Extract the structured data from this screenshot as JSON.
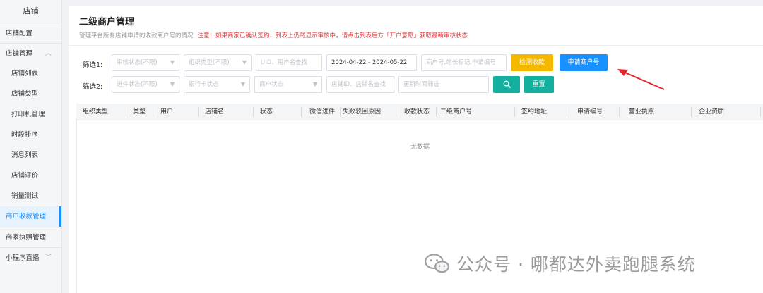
{
  "sidebar": {
    "title": "店铺",
    "items": [
      {
        "label": "店铺配置",
        "name": "sidebar-item-store-config",
        "type": "top",
        "sep": true
      },
      {
        "label": "店铺管理",
        "name": "sidebar-item-store-manage",
        "type": "group",
        "sep": true,
        "expanded": true
      },
      {
        "label": "店铺列表",
        "name": "sidebar-item-store-list",
        "type": "sub"
      },
      {
        "label": "店铺类型",
        "name": "sidebar-item-store-type",
        "type": "sub"
      },
      {
        "label": "打印机管理",
        "name": "sidebar-item-printer",
        "type": "sub"
      },
      {
        "label": "时段排序",
        "name": "sidebar-item-time-sort",
        "type": "sub"
      },
      {
        "label": "消息列表",
        "name": "sidebar-item-messages",
        "type": "sub"
      },
      {
        "label": "店铺评价",
        "name": "sidebar-item-reviews",
        "type": "sub"
      },
      {
        "label": "销量测试",
        "name": "sidebar-item-sales-test",
        "type": "sub"
      },
      {
        "label": "商户收款管理",
        "name": "sidebar-item-merchant-payment",
        "type": "top",
        "active": true
      },
      {
        "label": "商家执照管理",
        "name": "sidebar-item-license",
        "type": "top",
        "sep": true
      },
      {
        "label": "小程序直播",
        "name": "sidebar-item-mini-live",
        "type": "group",
        "sep": true,
        "expanded": false
      }
    ]
  },
  "page": {
    "title": "二级商户管理",
    "description": "管理平台所有店铺申请的收款商户号的情况",
    "warning": "注意：如果商家已确认签约，列表上仍然显示审核中，请点击列表后方「开户意愿」获取最新审核状态"
  },
  "filters": {
    "row1_label": "筛选1:",
    "row2_label": "筛选2:",
    "review_status": "审核状态(不限)",
    "org_type": "组织类型(不限)",
    "uid_placeholder": "UID、用户名查找",
    "date_range": "2024-04-22 - 2024-05-22",
    "merchant_placeholder": "商户号,站长标记,申请编号",
    "progress_status": "进件状态(不限)",
    "bank_card_status": "银行卡状态",
    "merchant_status": "商户状态",
    "store_placeholder": "店铺ID、店铺名查找",
    "update_time_placeholder": "更新时间筛选"
  },
  "buttons": {
    "check_payment": "检测收款",
    "apply_merchant": "申请商户号",
    "reset": "重置"
  },
  "table": {
    "columns": [
      "组织类型",
      "类型",
      "用户",
      "店铺名",
      "状态",
      "微信进件",
      "失败驳回原因",
      "收款状态",
      "二级商户号",
      "签约地址",
      "申请编号",
      "营业执照",
      "企业资质"
    ],
    "empty_text": "无数据"
  },
  "watermark": {
    "text": "公众号 · 哪都达外卖跑腿系统"
  },
  "colors": {
    "accent": "#1890ff",
    "orange": "#f5b800",
    "teal": "#13b0a0",
    "warning": "#e4393c"
  }
}
